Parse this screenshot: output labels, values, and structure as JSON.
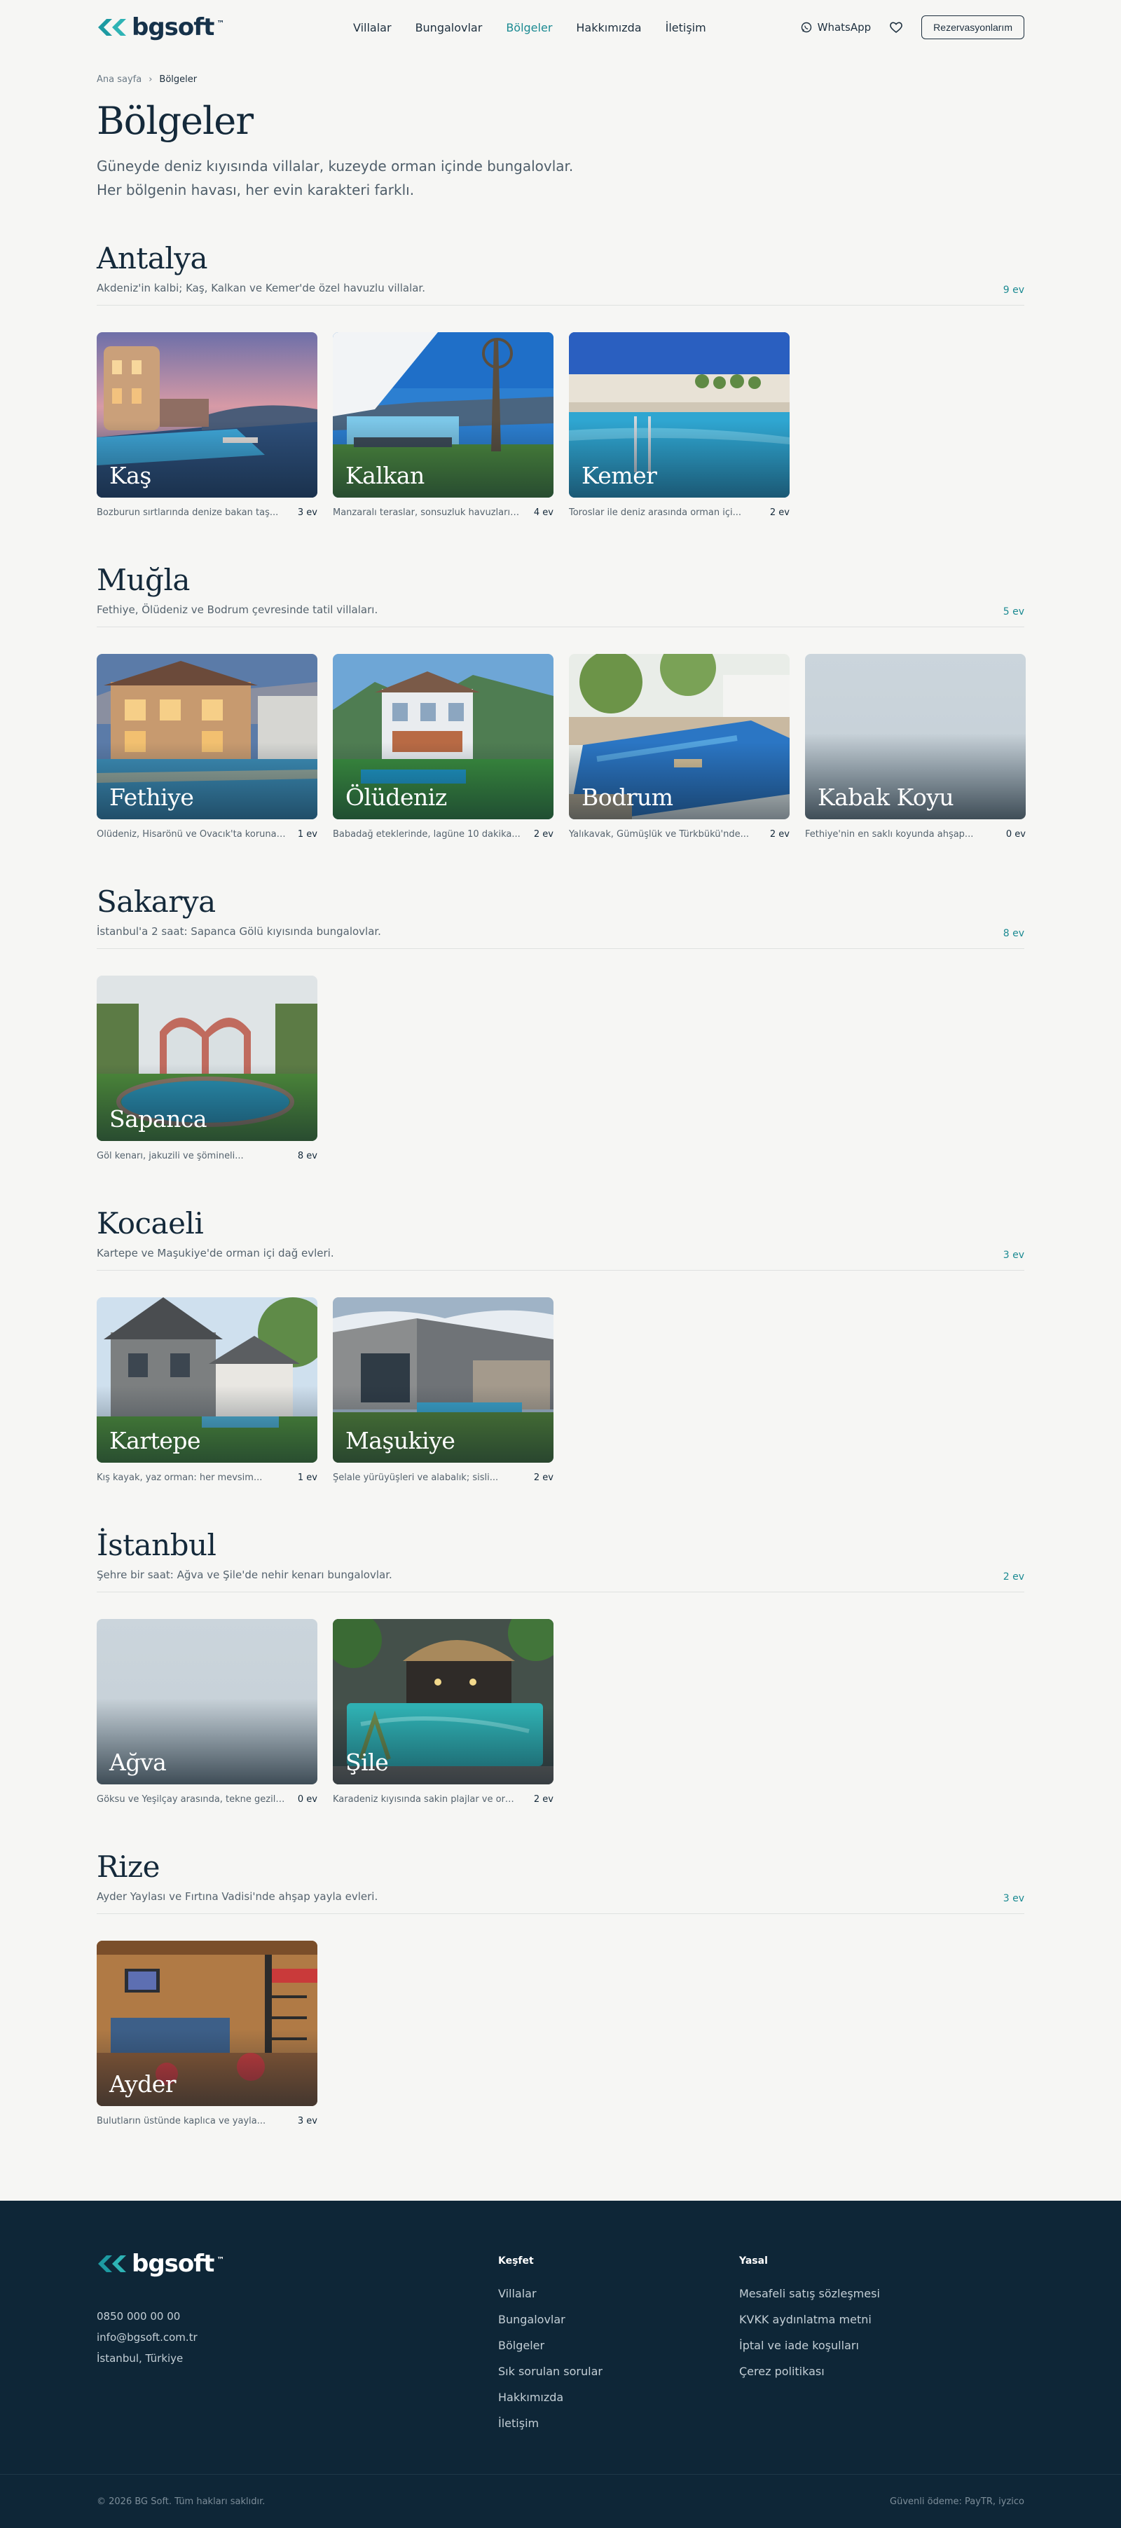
{
  "header": {
    "brand": "bgsoft",
    "brand_tm": "™",
    "nav": [
      "Villalar",
      "Bungalovlar",
      "Bölgeler",
      "Hakkımızda",
      "İletişim"
    ],
    "whatsapp": "WhatsApp",
    "reservations": "Rezervasyonlarım",
    "colors": {
      "accent": "#1b8a92",
      "ink": "#14293a",
      "footer": "#0e2637",
      "page_bg": "#f6f6f4"
    }
  },
  "breadcrumb": {
    "home": "Ana sayfa",
    "separator": "›",
    "current": "Bölgeler"
  },
  "page": {
    "title": "Bölgeler",
    "intro": "Güneyde deniz kıyısında villalar, kuzeyde orman içinde bungalovlar. Her bölgenin havası, her evin karakteri farklı."
  },
  "regions": [
    {
      "name": "Antalya",
      "desc": "Akdeniz'in kalbi; Kaş, Kalkan ve Kemer'de özel havuzlu villalar.",
      "count": "9 ev",
      "places": [
        {
          "name": "Kaş",
          "blurb": "Bozburun sırtlarında denize bakan taş...",
          "count": "3 ev",
          "image": "sunset-pool-villa"
        },
        {
          "name": "Kalkan",
          "blurb": "Manzaralı teraslar, sonsuzluk havuzları ve...",
          "count": "4 ev",
          "image": "infinity-pool-sea"
        },
        {
          "name": "Kemer",
          "blurb": "Toroslar ile deniz arasında orman içi...",
          "count": "2 ev",
          "image": "night-pool"
        }
      ]
    },
    {
      "name": "Muğla",
      "desc": "Fethiye, Ölüdeniz ve Bodrum çevresinde tatil villaları.",
      "count": "5 ev",
      "places": [
        {
          "name": "Fethiye",
          "blurb": "Ölüdeniz, Hisarönü ve Ovacık'ta korunakl...",
          "count": "1 ev",
          "image": "lit-villa-pool"
        },
        {
          "name": "Ölüdeniz",
          "blurb": "Babadağ eteklerinde, lagüne 10 dakika...",
          "count": "2 ev",
          "image": "mountain-villa"
        },
        {
          "name": "Bodrum",
          "blurb": "Yalıkavak, Gümüşlük ve Türkbükü'nde...",
          "count": "2 ev",
          "image": "garden-pool"
        },
        {
          "name": "Kabak Koyu",
          "blurb": "Fethiye'nin en saklı koyunda ahşap...",
          "count": "0 ev",
          "image": ""
        }
      ]
    },
    {
      "name": "Sakarya",
      "desc": "İstanbul'a 2 saat: Sapanca Gölü kıyısında bungalovlar.",
      "count": "8 ev",
      "places": [
        {
          "name": "Sapanca",
          "blurb": "Göl kenarı, jakuzili ve şömineli...",
          "count": "8 ev",
          "image": "round-bungalow"
        }
      ]
    },
    {
      "name": "Kocaeli",
      "desc": "Kartepe ve Maşukiye'de orman içi dağ evleri.",
      "count": "3 ev",
      "places": [
        {
          "name": "Kartepe",
          "blurb": "Kış kayak, yaz orman: her mevsim...",
          "count": "1 ev",
          "image": "stone-house"
        },
        {
          "name": "Maşukiye",
          "blurb": "Şelale yürüyüşleri ve alabalık; sisli...",
          "count": "2 ev",
          "image": "stone-house-pool"
        }
      ]
    },
    {
      "name": "İstanbul",
      "desc": "Şehre bir saat: Ağva ve Şile'de nehir kenarı bungalovlar.",
      "count": "2 ev",
      "places": [
        {
          "name": "Ağva",
          "blurb": "Göksu ve Yeşilçay arasında, tekne gezili...",
          "count": "0 ev",
          "image": ""
        },
        {
          "name": "Şile",
          "blurb": "Karadeniz kıyısında sakin plajlar ve orma...",
          "count": "2 ev",
          "image": "thatched-pool"
        }
      ]
    },
    {
      "name": "Rize",
      "desc": "Ayder Yaylası ve Fırtına Vadisi'nde ahşap yayla evleri.",
      "count": "3 ev",
      "places": [
        {
          "name": "Ayder",
          "blurb": "Bulutların üstünde kaplıca ve yayla...",
          "count": "3 ev",
          "image": "wooden-interior"
        }
      ]
    }
  ],
  "footer": {
    "brand": "bgsoft",
    "brand_tm": "™",
    "phone": "0850 000 00 00",
    "email": "info@bgsoft.com.tr",
    "city": "İstanbul, Türkiye",
    "explore_title": "Keşfet",
    "explore": [
      "Villalar",
      "Bungalovlar",
      "Bölgeler",
      "Sık sorulan sorular",
      "Hakkımızda",
      "İletişim"
    ],
    "legal_title": "Yasal",
    "legal": [
      "Mesafeli satış sözleşmesi",
      "KVKK aydınlatma metni",
      "İptal ve iade koşulları",
      "Çerez politikası"
    ],
    "copyright": "© 2026 BG Soft. Tüm hakları saklıdır.",
    "payment": "Güvenli ödeme: PayTR, iyzico"
  }
}
